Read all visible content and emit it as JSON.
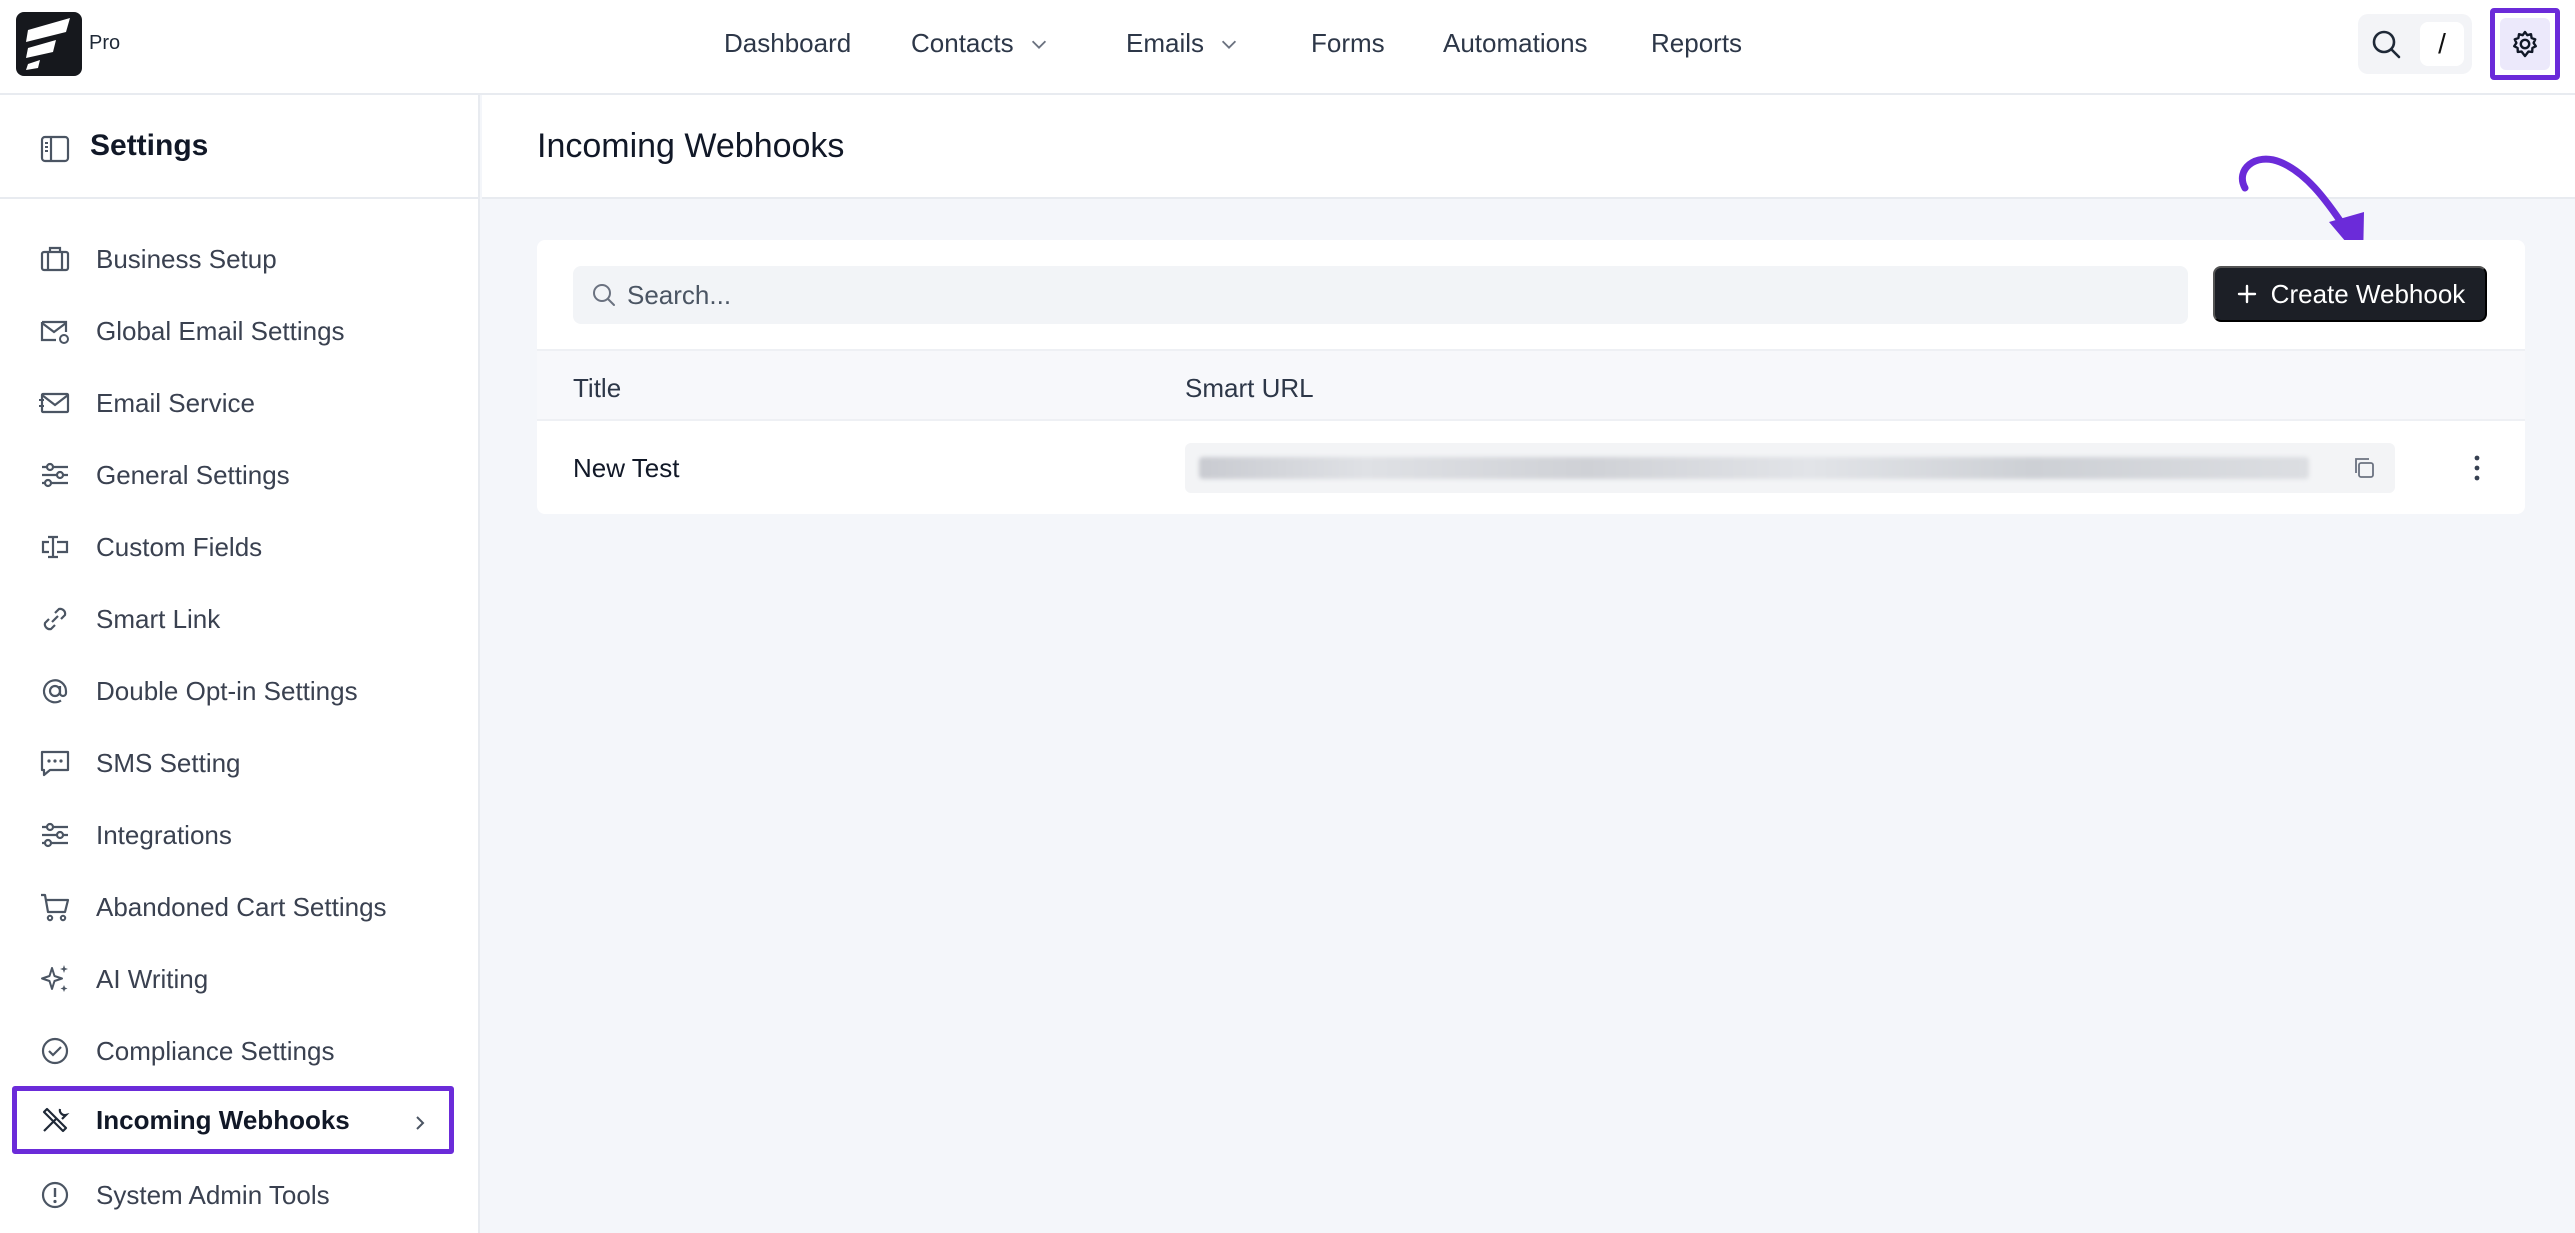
{
  "brand": {
    "badge": "Pro"
  },
  "nav": {
    "items": [
      {
        "label": "Dashboard",
        "has_dropdown": false
      },
      {
        "label": "Contacts",
        "has_dropdown": true
      },
      {
        "label": "Emails",
        "has_dropdown": true
      },
      {
        "label": "Forms",
        "has_dropdown": false
      },
      {
        "label": "Automations",
        "has_dropdown": false
      },
      {
        "label": "Reports",
        "has_dropdown": false
      }
    ],
    "shortcut_key": "/"
  },
  "sidebar": {
    "title": "Settings",
    "active_index": 12,
    "items": [
      {
        "label": "Business Setup",
        "icon": "briefcase-icon"
      },
      {
        "label": "Global Email Settings",
        "icon": "mail-settings-icon"
      },
      {
        "label": "Email Service",
        "icon": "mail-send-icon"
      },
      {
        "label": "General Settings",
        "icon": "sliders-icon"
      },
      {
        "label": "Custom Fields",
        "icon": "text-field-icon"
      },
      {
        "label": "Smart Link",
        "icon": "link-icon"
      },
      {
        "label": "Double Opt-in Settings",
        "icon": "at-sign-icon"
      },
      {
        "label": "SMS Setting",
        "icon": "message-icon"
      },
      {
        "label": "Integrations",
        "icon": "sliders-icon"
      },
      {
        "label": "Abandoned Cart Settings",
        "icon": "cart-icon"
      },
      {
        "label": "AI Writing",
        "icon": "sparkles-icon"
      },
      {
        "label": "Compliance Settings",
        "icon": "check-circle-icon"
      },
      {
        "label": "Incoming Webhooks",
        "icon": "tools-icon"
      },
      {
        "label": "System Admin Tools",
        "icon": "alert-circle-icon"
      }
    ]
  },
  "page": {
    "title": "Incoming Webhooks"
  },
  "search": {
    "placeholder": "Search..."
  },
  "toolbar": {
    "create_label": "Create Webhook"
  },
  "table": {
    "columns": [
      "Title",
      "Smart URL"
    ],
    "rows": [
      {
        "title": "New Test"
      }
    ]
  },
  "colors": {
    "highlight": "#6b2bd9",
    "primary_button": "#1c1f26"
  }
}
